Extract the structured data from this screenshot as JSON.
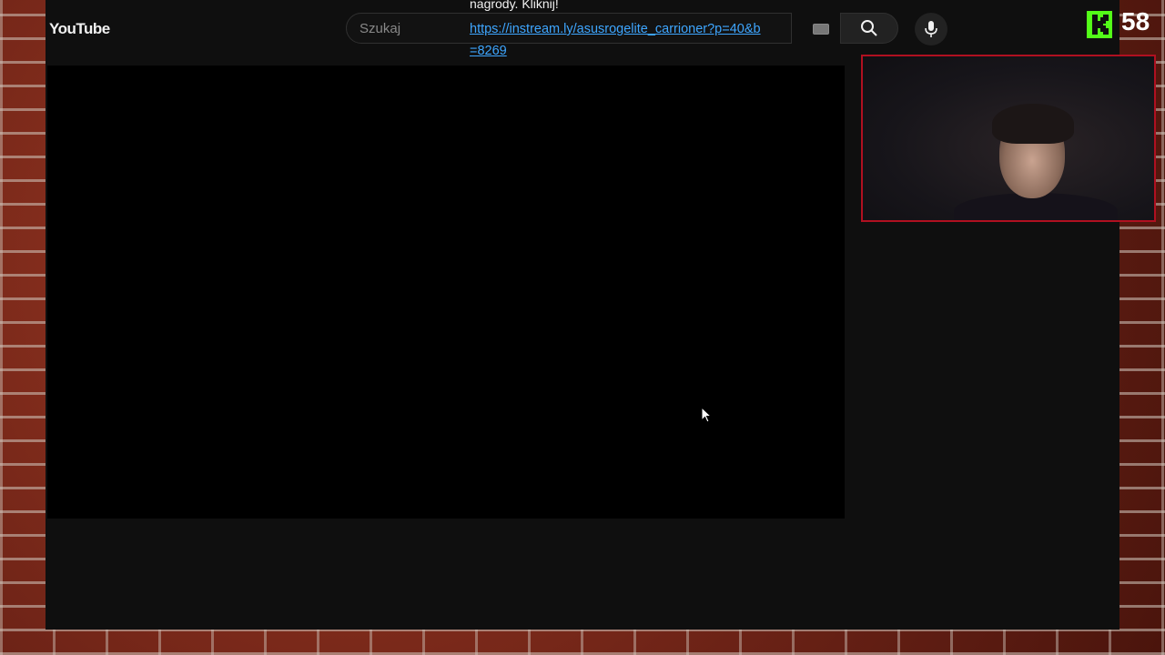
{
  "header": {
    "logo_text": "YouTube",
    "search_placeholder": "Szukaj"
  },
  "overlay": {
    "message": "nagrody. Kliknij!",
    "link": "https://instream.ly/asusrogelite_carrioner?p=40&b=8269"
  },
  "stream": {
    "viewer_count": "58",
    "platform_icon": "kick-icon"
  },
  "colors": {
    "accent_link": "#3ea6ff",
    "kick_green": "#53fc18",
    "webcam_border": "#b01020"
  }
}
